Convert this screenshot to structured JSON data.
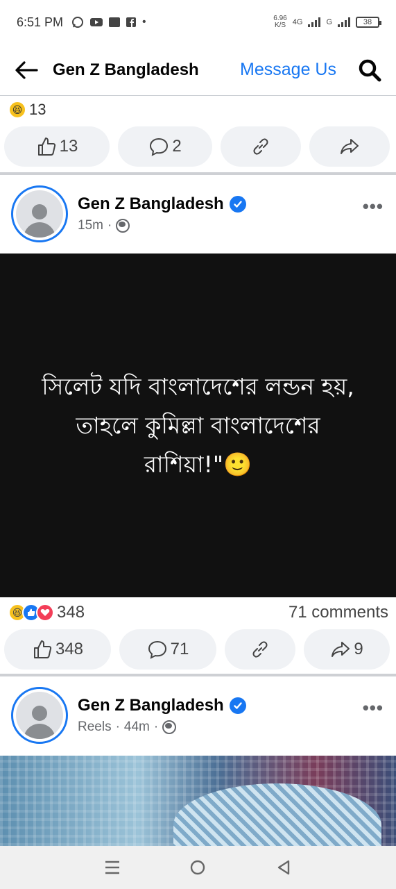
{
  "status_bar": {
    "time": "6:51 PM",
    "net_speed_value": "6.96",
    "net_speed_unit": "K/S",
    "network_1": "4G",
    "network_2": "G",
    "battery": "38"
  },
  "header": {
    "title": "Gen Z Bangladesh",
    "message_us": "Message Us"
  },
  "prev_post": {
    "reaction_count": "13",
    "like_count": "13",
    "comment_count": "2"
  },
  "post1": {
    "page_name": "Gen Z Bangladesh",
    "time": "15m",
    "separator": "·",
    "text_line1": "সিলেট যদি বাংলাদেশের লন্ডন হয়,",
    "text_line2": "তাহলে কুমিল্লা  বাংলাদেশের",
    "text_line3": "রাশিয়া!\"🙂",
    "reaction_count": "348",
    "comments_text": "71 comments",
    "like_count": "348",
    "comment_count": "71",
    "share_count": "9"
  },
  "post2": {
    "page_name": "Gen Z Bangladesh",
    "type": "Reels",
    "separator": "·",
    "time": "44m"
  },
  "icons": {
    "more": "•••"
  },
  "colors": {
    "accent": "#1877f2",
    "pill_bg": "#f0f2f5",
    "post_bg": "#111111"
  }
}
